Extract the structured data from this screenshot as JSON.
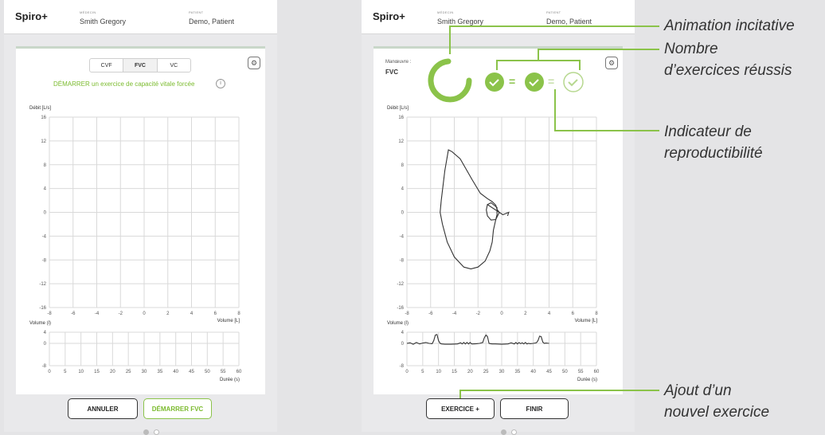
{
  "left_screen": {
    "header": {
      "app_title": "Spiro+",
      "doctor_label": "MÉDECIN",
      "doctor_name": "Smith Gregory",
      "patient_label": "PATIENT",
      "patient_name": "Demo, Patient"
    },
    "tabs": [
      {
        "label": "CVF",
        "selected": false
      },
      {
        "label": "FVC",
        "selected": true
      },
      {
        "label": "VC",
        "selected": false
      }
    ],
    "start_message": "DÉMARRER un exercice de capacité vitale forcée",
    "info_icon": "i",
    "buttons": {
      "cancel": "ANNULER",
      "start": "DÉMARRER FVC"
    }
  },
  "right_screen": {
    "header": {
      "app_title": "Spiro+",
      "doctor_label": "MÉDECIN",
      "doctor_name": "Smith Gregory",
      "patient_label": "PATIENT",
      "patient_name": "Demo, Patient"
    },
    "maneuver_label": "Manœuvre :",
    "maneuver_value": "FVC",
    "buttons": {
      "add_exercise": "EXERCICE +",
      "finish": "FINIR"
    }
  },
  "annotations": {
    "animation": "Animation incitative",
    "successful_1": "Nombre",
    "successful_2": "d’exercices réussis",
    "repro_1": "Indicateur de",
    "repro_2": "reproductibilité",
    "add_1": "Ajout d’un",
    "add_2": "nouvel exercice"
  },
  "colors": {
    "accent": "#8bc34a",
    "accent_text": "#7bbb2e",
    "annotation_line": "#8bc34a"
  },
  "icons": {
    "settings": "gear-icon",
    "check": "check-icon"
  },
  "chart_data": [
    {
      "type": "line",
      "chart": "flow-volume",
      "ylabel": "Débit [L/s]",
      "xlabel": "Volume [L]",
      "xlim": [
        -8,
        8
      ],
      "ylim": [
        -16,
        16
      ],
      "xticks": [
        -8,
        -6,
        -4,
        -2,
        0,
        2,
        4,
        6,
        8
      ],
      "yticks": [
        16,
        12,
        8,
        4,
        0,
        -4,
        -8,
        -12,
        -16
      ],
      "grid": true,
      "series": []
    },
    {
      "type": "line",
      "chart": "volume-time",
      "ylabel": "Volume (l)",
      "xlabel": "Durée (s)",
      "xlim": [
        0,
        60
      ],
      "ylim": [
        -8,
        4
      ],
      "xticks": [
        0,
        5,
        10,
        15,
        20,
        25,
        30,
        35,
        40,
        45,
        50,
        55,
        60
      ],
      "yticks": [
        -8,
        0,
        4
      ],
      "grid": true,
      "series": []
    },
    {
      "type": "line",
      "chart": "flow-volume",
      "ylabel": "Débit [L/s]",
      "xlabel": "Volume [L]",
      "xlim": [
        -8,
        8
      ],
      "ylim": [
        -16,
        16
      ],
      "xticks": [
        -8,
        -6,
        -4,
        -2,
        0,
        2,
        4,
        6,
        8
      ],
      "yticks": [
        16,
        12,
        8,
        4,
        0,
        -4,
        -8,
        -12,
        -16
      ],
      "grid": true,
      "series": [
        {
          "x": [
            -5.2,
            -5.1,
            -4.8,
            -4.5,
            -4.2,
            -3.5,
            -2.5,
            -1.8,
            -1.2,
            -0.8,
            -0.5,
            -0.4,
            -0.2,
            -0.5,
            -0.7,
            -0.8,
            -1.0,
            -1.4,
            -2.0,
            -2.6,
            -3.2,
            -4.0,
            -4.6,
            -5.0,
            -5.2
          ],
          "y": [
            0,
            2,
            7,
            10.5,
            10.2,
            9.0,
            5.5,
            3.2,
            2.3,
            1.8,
            1.2,
            0.5,
            0,
            -1.2,
            -3,
            -5,
            -6.5,
            -8.2,
            -9.2,
            -9.5,
            -9.2,
            -7.5,
            -5,
            -2,
            0
          ]
        },
        {
          "x": [
            -1.2,
            -0.9,
            -0.4,
            -0.4,
            -0.5,
            -0.9,
            -1.2,
            -1.3,
            -1.2,
            0.1,
            0.6,
            0.5
          ],
          "y": [
            1.3,
            1.6,
            0.8,
            -0.4,
            -1.2,
            -1.3,
            -0.6,
            0.4,
            1.3,
            -0.4,
            0.0,
            -0.6
          ]
        }
      ]
    },
    {
      "type": "line",
      "chart": "volume-time",
      "ylabel": "Volume (l)",
      "xlabel": "Durée (s)",
      "xlim": [
        0,
        60
      ],
      "ylim": [
        -8,
        4
      ],
      "xticks": [
        0,
        5,
        10,
        15,
        20,
        25,
        30,
        35,
        40,
        45,
        50,
        55,
        60
      ],
      "yticks": [
        -8,
        0,
        4
      ],
      "grid": true,
      "series": [
        {
          "x": [
            0,
            1,
            2,
            3,
            4,
            5,
            6,
            7,
            8,
            8.5,
            9,
            9.5,
            10,
            10.5,
            11,
            12,
            14,
            16,
            17,
            17.5,
            18,
            18.5,
            19,
            19.5,
            20,
            20.5,
            21,
            22,
            23,
            24,
            24.5,
            25,
            25.5,
            26,
            26.5,
            27,
            28,
            30,
            32,
            33,
            34,
            34.5,
            35,
            35.5,
            36,
            36.5,
            37,
            37.5,
            38,
            38.5,
            39,
            40,
            41,
            41.5,
            42,
            42.5,
            43,
            43.5,
            44,
            45
          ],
          "y": [
            0,
            0.2,
            -0.3,
            0.3,
            -0.2,
            0.1,
            0.3,
            0,
            -0.1,
            1,
            3,
            3.2,
            1,
            0,
            -0.2,
            -0.3,
            -0.3,
            -0.2,
            0.2,
            -0.2,
            0.3,
            -0.2,
            0.3,
            -0.2,
            0.3,
            -0.2,
            -0.2,
            -0.1,
            0,
            0.3,
            2,
            3,
            2.5,
            0,
            -0.1,
            -0.2,
            -0.2,
            -0.3,
            -0.2,
            0.2,
            -0.2,
            0.3,
            -0.2,
            0.3,
            -0.1,
            0.2,
            -0.2,
            0.3,
            -0.2,
            0,
            -0.1,
            0,
            0.2,
            1,
            2.6,
            2.4,
            0.5,
            0,
            0.1,
            0
          ]
        }
      ]
    }
  ]
}
